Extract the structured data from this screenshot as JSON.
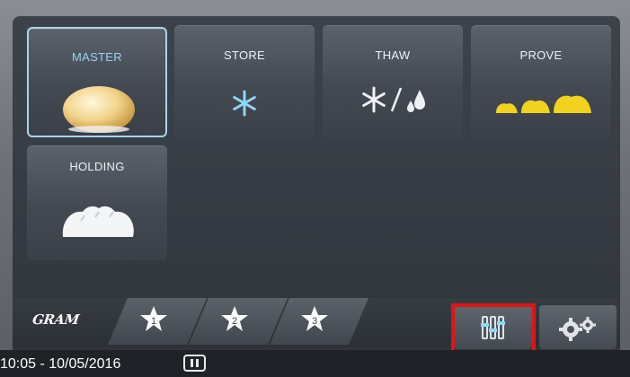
{
  "tiles": {
    "master": {
      "label": "MASTER"
    },
    "store": {
      "label": "STORE"
    },
    "thaw": {
      "label": "THAW"
    },
    "prove": {
      "label": "PROVE"
    },
    "holding": {
      "label": "HOLDING"
    }
  },
  "favorites": {
    "logo": "GRAM",
    "tabs": [
      {
        "number": "1"
      },
      {
        "number": "2"
      },
      {
        "number": "3"
      }
    ]
  },
  "status": {
    "datetime": "10:05 - 10/05/2016"
  },
  "colors": {
    "selected_outline": "#a6d5ec",
    "snowflake": "#8fd6f5",
    "bread_yellow": "#f1d21c",
    "highlight_red": "#e01414"
  },
  "icons": [
    "bread-roll-icon",
    "snowflake-icon",
    "water-drops-icon",
    "bread-loaves-icon",
    "star-icon",
    "pause-icon",
    "sliders-icon",
    "gears-icon"
  ]
}
